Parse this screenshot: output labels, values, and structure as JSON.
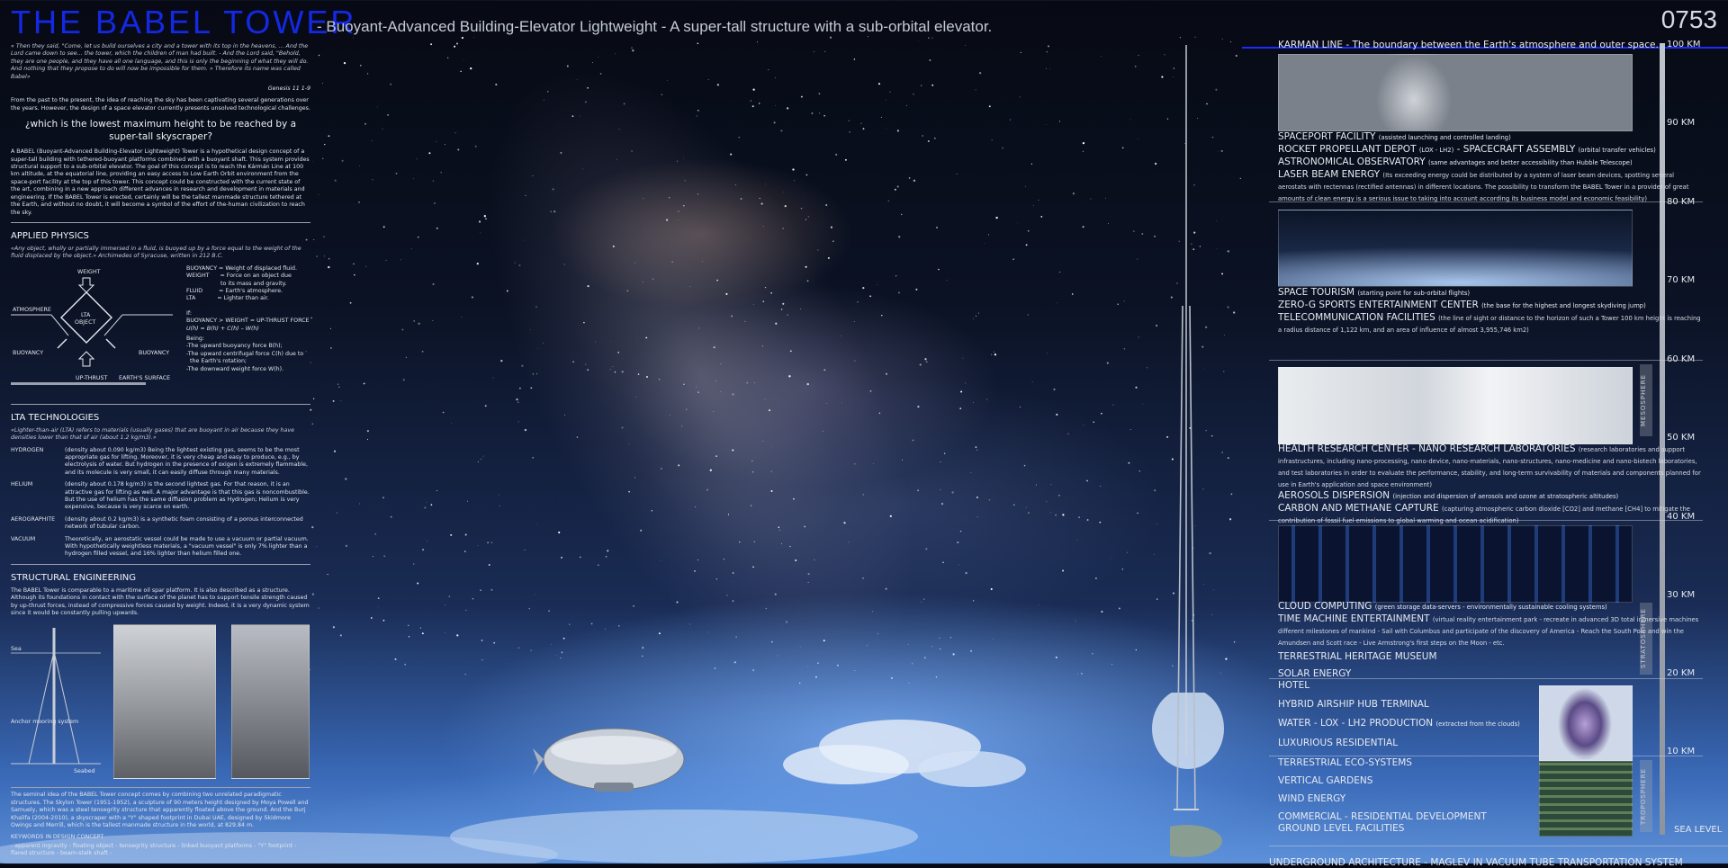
{
  "title": {
    "main": "THE BABEL TOWER",
    "subtitle": "- Buoyant-Advanced Building-Elevator Lightweight - A super-tall structure with a sub-orbital elevator.",
    "code": "0753"
  },
  "intro": {
    "quote": "« Then they said, \"Come, let us build ourselves a city and a tower with its top in the heavens, ... And the Lord came down to see... the tower, which the children of man had built. - And the Lord said, \"Behold, they are one people, and they have all one language, and this is only the beginning of what they will do. And nothing that they propose to do will now be impossible for them. » Therefore its name was called Babel»",
    "quote_ref": "Genesis 11 1-9",
    "p1": "From the past to the present, the idea of reaching the sky has been captivating several generations over the years. However, the design of a space elevator currently presents unsolved technological challenges.",
    "question": "¿which is the lowest maximum height to be reached by a super-tall skyscraper?",
    "p2": "A BABEL (Buoyant-Advanced Building-Elevator Lightweight) Tower is a hypothetical design concept of a super-tall building with tethered-buoyant platforms combined with a buoyant shaft. This system provides structural support to a sub-orbital elevator. The goal of this concept is to reach the Kármán Line at 100 km altitude, at the equatorial line, providing an easy access to Low Earth Orbit environment from the space-port facility at the top of this tower. This concept could be constructed with the current state of the art, combining in a new approach different advances in research and development in materials and engineering. If the BABEL Tower is erected, certainly will be the tallest manmade structure tethered at the Earth, and without no doubt, it will become a symbol of the effort of the-human civilization to reach the sky."
  },
  "physics": {
    "title": "APPLIED PHYSICS",
    "quote": "«Any object, wholly or partially immersed in a fluid, is buoyed up by a force equal to the weight of the fluid displaced by the object.» Archimedes of Syracuse, written in 212 B.C.",
    "diagram": {
      "weight": "WEIGHT",
      "atmosphere": "ATMOSPHERE",
      "lta1": "LTA",
      "lta2": "OBJECT",
      "buoy_l": "BUOYANCY",
      "buoy_r": "BUOYANCY",
      "upthrust": "UP-THRUST",
      "surface": "EARTH'S SURFACE"
    },
    "defs": [
      "BUOYANCY = Weight of displaced fluid.",
      "WEIGHT      = Force on an object due",
      "                   to its mass and gravity.",
      "FLUID         = Earth's atmosphere.",
      "LTA            = Lighter than air."
    ],
    "if": "If:",
    "cond": "BUOYANCY > WEIGHT = UP-THRUST FORCE",
    "formula": "U(h) = B(h) + C(h) – W(h)",
    "being": "Being:",
    "items": [
      "-The upward buoyancy force B(h);",
      "-The upward centrifugal force C(h) due to",
      "  the Earth's rotation;",
      "-The downward weight force W(h)."
    ]
  },
  "lta": {
    "title": "LTA TECHNOLOGIES",
    "quote": "«Lighter-than-air (LTA) refers to materials (usually gases) that are buoyant in air because they have densities lower than that of air (about 1.2 kg/m3).»",
    "rows": [
      {
        "k": "HYDROGEN",
        "v": "(density about 0.090 kg/m3) Being the lightest existing gas, seems to be the most appropriate gas for lifting. Moreover, it is very cheap and easy to produce, e.g., by electrolysis of water. But hydrogen in the presence of oxigen is extremely flammable, and its molecule is very small, it can easily diffuse through many materials."
      },
      {
        "k": "HELIUM",
        "v": "(density about 0.178 kg/m3) is the second lightest gas. For that reason, it is an attractive gas for lifting as well. A major advantage is that this gas is noncombustible. But the use of helium has the same diffusion problem as Hydrogen; Helium is very expensive, because is very scarce on earth."
      },
      {
        "k": "AEROGRAPHITE",
        "v": "(density about 0.2 kg/m3) is a synthetic foam consisting of a porous interconnected network of tubular carbon."
      },
      {
        "k": "VACUUM",
        "v": "Theoretically, an aerostatic vessel could be made to use a vacuum or partial vacuum. With hypothetically weightless materials, a \"vacuum vessel\" is only 7% lighter than a hydrogen filled vessel, and 16% lighter than helium filled one."
      }
    ]
  },
  "structural": {
    "title": "STRUCTURAL ENGINEERING",
    "p": "The BABEL Tower is comparable to a maritime oil spar platform. It is also described as a structure. Although its foundations in contact with the surface of the planet has to support tensile strength caused by up-thrust forces, instead of compressive forces caused by weight. Indeed, it is a very dynamic system since it would be constantly pulling upwards.",
    "labels": {
      "sea": "Sea",
      "anchor": "Anchor mooring system",
      "seabed": "Seabed"
    },
    "p2": "The seminal idea of the BABEL Tower concept comes by combining two unrelated paradigmatic structures. The Skylon Tower (1951-1952), a sculpture of 90 meters height designed by Moya Powell and Samuely, which was a steel tensegrity structure that apparently floated above the ground. And the Burj Khalifa (2004-2010), a skyscraper with a \"Y\" shaped footprint in Dubai UAE, designed by Skidmore Owings and Merrill, which is the tallest manmade structure in the world, at 829.84 m.",
    "kw_title": "KEYWORDS IN DESIGN CONCEPT",
    "kw": "- apparent ingravity - floating object - tensegrity structure - linked buoyant platforms - \"Y\" footprint - flared structure - beam-stalk shaft -"
  },
  "right": {
    "karman": "KARMAN LINE -  The boundary between the Earth's atmosphere and outer space.",
    "b90": [
      {
        "t": "SPACEPORT FACILITY",
        "s": "(assisted launching and controlled landing)"
      },
      {
        "t": "ROCKET PROPELLANT DEPOT",
        "s": "(LOX - LH2)",
        "t2": " - SPACECRAFT ASSEMBLY",
        "s2": "(orbital transfer vehicles)"
      },
      {
        "t": "ASTRONOMICAL OBSERVATORY",
        "s": "(same advantages and better accessibility than Hubble Telescope)"
      },
      {
        "t": "LASER BEAM ENERGY",
        "s": "(Its exceeding energy could be distributed  by a system of laser beam devices, spotting several aerostats with rectennas (rectified antennas) in different locations. The possibility to transform the BABEL Tower in a provider of great amounts of clean energy is a serious issue to taking into account according its business model and economic feasibility)"
      }
    ],
    "b70": [
      {
        "t": "SPACE TOURISM",
        "s": "(starting point for sub-orbital flights)"
      },
      {
        "t": "ZERO-G SPORTS ENTERTAINMENT CENTER",
        "s": "(the base for the highest and longest skydiving jump)"
      },
      {
        "t": "TELECOMMUNICATION FACILITIES",
        "s": "(the line of sight or distance to the horizon of such a Tower 100 km height is reaching a radius distance of 1,122 km, and an area of influence of almost 3,955,746 km2)"
      }
    ],
    "b50": [
      {
        "t": "HEALTH RESEARCH CENTER - NANO RESEARCH LABORATORIES",
        "s": "(research laboratories and support infrastructures, including nano-processing, nano-device, nano-materials, nano-structures, nano-medicine and nano-biotech laboratories, and test laboratories in order to evaluate the performance, stability, and long-term survivability of materials and components planned for use in Earth's application and space environment)"
      },
      {
        "t": "AEROSOLS DISPERSION",
        "s": "(injection and dispersion of aerosols and ozone at stratospheric altitudes)"
      },
      {
        "t": "CARBON AND METHANE CAPTURE",
        "s": "(capturing atmospheric carbon dioxide [CO2] and methane [CH4] to mitigate the contribution of fossil fuel emissions to global warming and ocean acidification)"
      }
    ],
    "b30": [
      {
        "t": "CLOUD COMPUTING",
        "s": "(green storage data-servers - environmentally sustainable cooling systems)"
      },
      {
        "t": "TIME MACHINE ENTERTAINMENT",
        "s": "(virtual reality entertainment park - recreate in advanced 3D total inmersive machines different milestones of mankind - Sail with Columbus and participate of the discovery of America - Reach the South Pole and win the Amundsen and Scott race - Live Armstrong's first steps on the Moon - etc."
      },
      {
        "t": "TERRESTRIAL HERITAGE MUSEUM",
        "s": ""
      },
      {
        "t": "SOLAR ENERGY",
        "s": ""
      }
    ],
    "b10": [
      {
        "t": "HOTEL",
        "s": ""
      },
      {
        "t": "HYBRID AIRSHIP HUB TERMINAL",
        "s": ""
      },
      {
        "t": "WATER - LOX - LH2 PRODUCTION",
        "s": "(extracted from the clouds)"
      },
      {
        "t": "LUXURIOUS RESIDENTIAL",
        "s": ""
      }
    ],
    "b0": [
      {
        "t": "TERRESTRIAL ECO-SYSTEMS",
        "s": ""
      },
      {
        "t": "VERTICAL GARDENS",
        "s": ""
      },
      {
        "t": "WIND ENERGY",
        "s": ""
      },
      {
        "t": "COMMERCIAL - RESIDENTIAL DEVELOPMENT",
        "s": ""
      },
      {
        "t": "GROUND LEVEL FACILITIES",
        "s": ""
      }
    ],
    "underground": "UNDERGROUND ARCHITECTURE - MAGLEV IN VACUUM TUBE TRANSPORTATION SYSTEM"
  },
  "scale": [
    "100 KM",
    "90 KM",
    "80 KM",
    "70 KM",
    "60 KM",
    "50 KM",
    "40 KM",
    "30 KM",
    "20 KM",
    "10 KM",
    "SEA LEVEL"
  ],
  "layers": [
    "MESOSPHERE",
    "STRATOSPHERE",
    "TROPOSPHERE"
  ],
  "colors": {
    "title": "#1428e6",
    "karman_line": "#1b2cff"
  }
}
